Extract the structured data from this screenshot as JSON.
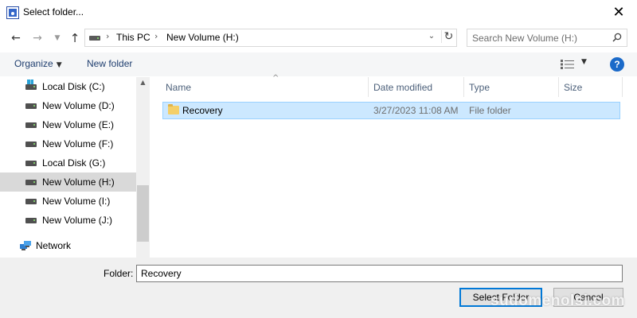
{
  "window": {
    "title": "Select folder..."
  },
  "navigation": {
    "breadcrumbs": [
      "This PC",
      "New Volume (H:)"
    ],
    "search_placeholder": "Search New Volume (H:)"
  },
  "toolbar": {
    "organize_label": "Organize",
    "new_folder_label": "New folder",
    "help_label": "?"
  },
  "sidebar": {
    "items": [
      {
        "label": "Local Disk (C:)",
        "icon": "windows-drive-icon",
        "selected": false
      },
      {
        "label": "New Volume (D:)",
        "icon": "drive-icon",
        "selected": false
      },
      {
        "label": "New Volume (E:)",
        "icon": "drive-icon",
        "selected": false
      },
      {
        "label": "New Volume (F:)",
        "icon": "drive-icon",
        "selected": false
      },
      {
        "label": "Local Disk (G:)",
        "icon": "drive-icon",
        "selected": false
      },
      {
        "label": "New Volume (H:)",
        "icon": "drive-icon",
        "selected": true
      },
      {
        "label": "New Volume (I:)",
        "icon": "drive-icon",
        "selected": false
      },
      {
        "label": "New Volume (J:)",
        "icon": "drive-icon",
        "selected": false
      }
    ],
    "network_label": "Network"
  },
  "file_list": {
    "columns": [
      "Name",
      "Date modified",
      "Type",
      "Size"
    ],
    "rows": [
      {
        "name": "Recovery",
        "date_modified": "3/27/2023 11:08 AM",
        "type": "File folder",
        "size": "",
        "selected": true
      }
    ]
  },
  "footer": {
    "folder_label": "Folder:",
    "folder_value": "Recovery",
    "select_button_label": "Select Folder",
    "cancel_button_label": "Cancel",
    "watermark": "sudomenolsi.com"
  },
  "colors": {
    "accent": "#0078d7",
    "selection": "#cce8ff",
    "sidebar_selection": "#d9d9d9",
    "help": "#1b6ac9"
  }
}
